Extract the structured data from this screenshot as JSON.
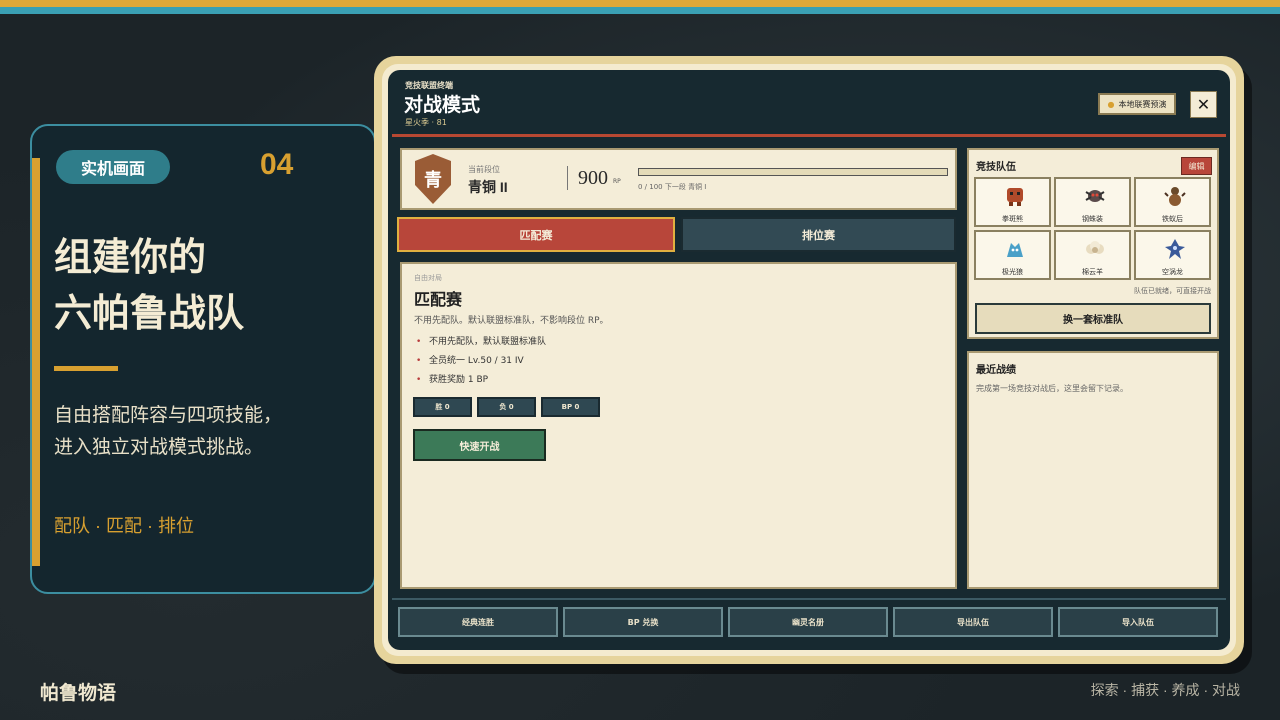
{
  "slide": {
    "tag": "实机画面",
    "number": "04",
    "headline": [
      "组建你的",
      "六帕鲁战队"
    ],
    "description": [
      "自由搭配阵容与四项技能，",
      "进入独立对战模式挑战。"
    ],
    "keywords": "配队 · 匹配 · 排位",
    "brand": "帕鲁物语",
    "footer": "探索 · 捕获 · 养成 · 对战"
  },
  "window": {
    "kicker": "竞技联盟终端",
    "title": "对战模式",
    "subtitle": "星火季 · 81",
    "preview_button": "本地联赛预演",
    "close_icon": "✕"
  },
  "rank": {
    "badge": "青",
    "label": "当前段位",
    "name": "青铜 II",
    "points": "900",
    "unit": "RP",
    "progress_text": "0 / 100  下一段 青铜 I",
    "progress_fraction": 0
  },
  "tabs": {
    "match": "匹配赛",
    "ranked": "排位赛"
  },
  "mode": {
    "kicker": "自由对局",
    "title": "匹配赛",
    "description": "不用先配队。默认联盟标准队，不影响段位 RP。",
    "bullets": [
      "不用先配队，默认联盟标准队",
      "全员统一 Lv.50 / 31 IV",
      "获胜奖励 1 BP"
    ],
    "stats": {
      "wins": "胜 0",
      "losses": "负 0",
      "bp": "BP 0"
    },
    "quick_button": "快速开战"
  },
  "team": {
    "title": "竞技队伍",
    "edit": "编辑",
    "members": [
      {
        "name": "拳斑熊",
        "color": "#b04a2a"
      },
      {
        "name": "钢蛛装",
        "color": "#5a4a4a"
      },
      {
        "name": "铁蚁后",
        "color": "#6a4a2a"
      },
      {
        "name": "极光狼",
        "color": "#4aa0c8"
      },
      {
        "name": "棉云羊",
        "color": "#c8b490"
      },
      {
        "name": "空涡龙",
        "color": "#3a5a9a"
      }
    ],
    "ready_note": "队伍已就绪，可直接开战",
    "swap_button": "换一套标准队"
  },
  "records": {
    "title": "最近战绩",
    "empty": "完成第一场竞技对战后，这里会留下记录。"
  },
  "bottom_nav": [
    "经典连胜",
    "BP 兑换",
    "幽灵名册",
    "导出队伍",
    "导入队伍"
  ]
}
